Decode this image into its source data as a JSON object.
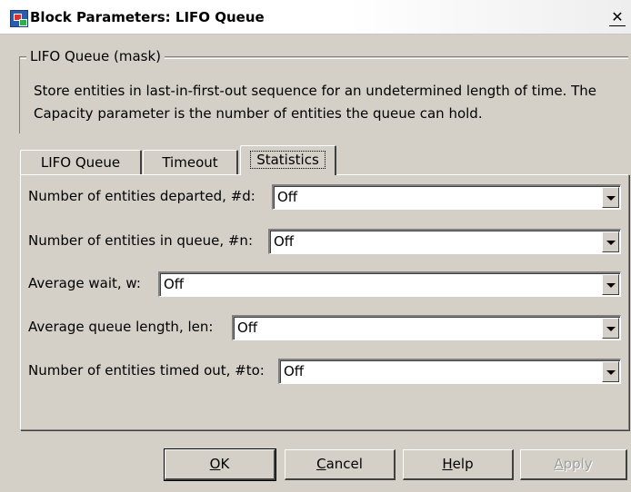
{
  "window": {
    "title": "Block Parameters: LIFO Queue",
    "close_glyph": "✕"
  },
  "mask": {
    "legend": "LIFO Queue (mask)",
    "description": "Store entities in last-in-first-out sequence for an undetermined length of time. The Capacity parameter is the number of entities the queue can hold."
  },
  "tabs": [
    {
      "label": "LIFO Queue",
      "active": false
    },
    {
      "label": "Timeout",
      "active": false
    },
    {
      "label": "Statistics",
      "active": true
    }
  ],
  "params": [
    {
      "label": "Number of entities departed, #d:",
      "value": "Off"
    },
    {
      "label": "Number of entities in queue, #n:",
      "value": "Off"
    },
    {
      "label": "Average wait, w:",
      "value": "Off"
    },
    {
      "label": "Average queue length, len:",
      "value": "Off"
    },
    {
      "label": "Number of entities timed out, #to:",
      "value": "Off"
    }
  ],
  "buttons": {
    "ok": {
      "mnemonic": "O",
      "rest": "K"
    },
    "cancel": {
      "mnemonic": "C",
      "rest": "ancel"
    },
    "help": {
      "mnemonic": "H",
      "rest": "elp"
    },
    "apply": {
      "mnemonic": "A",
      "rest": "pply",
      "disabled": true
    }
  }
}
